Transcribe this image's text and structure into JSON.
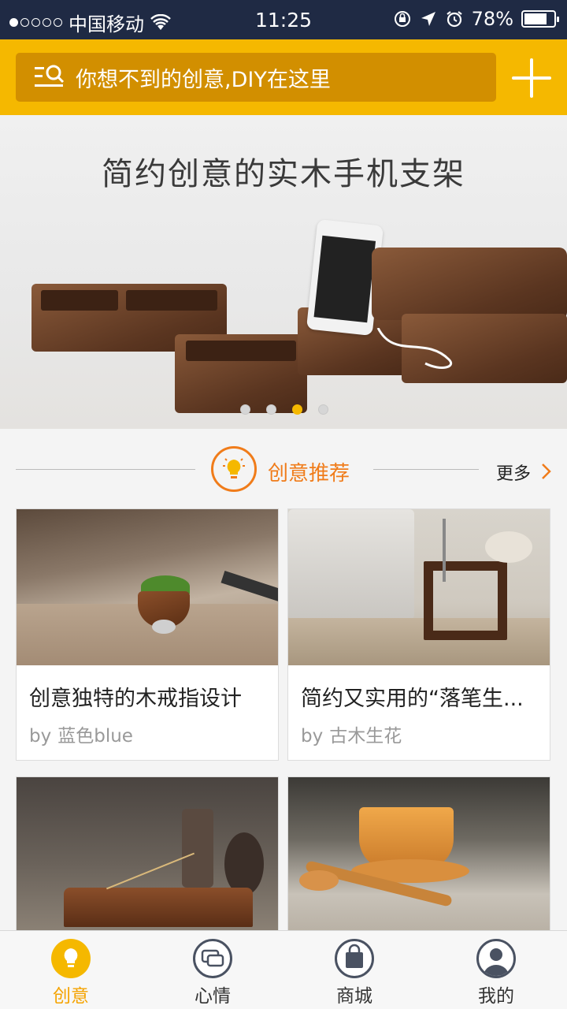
{
  "status_bar": {
    "carrier": "中国移动",
    "time": "11:25",
    "battery": "78%",
    "battery_level": 0.78
  },
  "header": {
    "search_placeholder": "你想不到的创意,DIY在这里",
    "search_icon": "search-list-icon",
    "add_icon": "plus-icon"
  },
  "banner": {
    "title": "简约创意的实木手机支架",
    "slide_count": 4,
    "active_slide": 3
  },
  "section": {
    "title": "创意推荐",
    "more_label": "更多"
  },
  "cards": [
    {
      "title": "创意独特的木戒指设计",
      "by": "by",
      "author": "蓝色blue"
    },
    {
      "title": "简约又实用的“落笔生...",
      "by": "by",
      "author": "古木生花"
    },
    {
      "title": "",
      "by": "",
      "author": ""
    },
    {
      "title": "",
      "by": "",
      "author": ""
    }
  ],
  "tabbar": {
    "tabs": [
      {
        "label": "创意",
        "icon": "lightbulb-icon",
        "active": true
      },
      {
        "label": "心情",
        "icon": "chat-bubble-icon",
        "active": false
      },
      {
        "label": "商城",
        "icon": "shopping-bag-icon",
        "active": false
      },
      {
        "label": "我的",
        "icon": "user-icon",
        "active": false
      }
    ]
  },
  "colors": {
    "brand_yellow": "#f5b800",
    "search_bg": "#d28f00",
    "accent_orange": "#f07c1a",
    "status_bar_bg": "#1f2a44"
  }
}
